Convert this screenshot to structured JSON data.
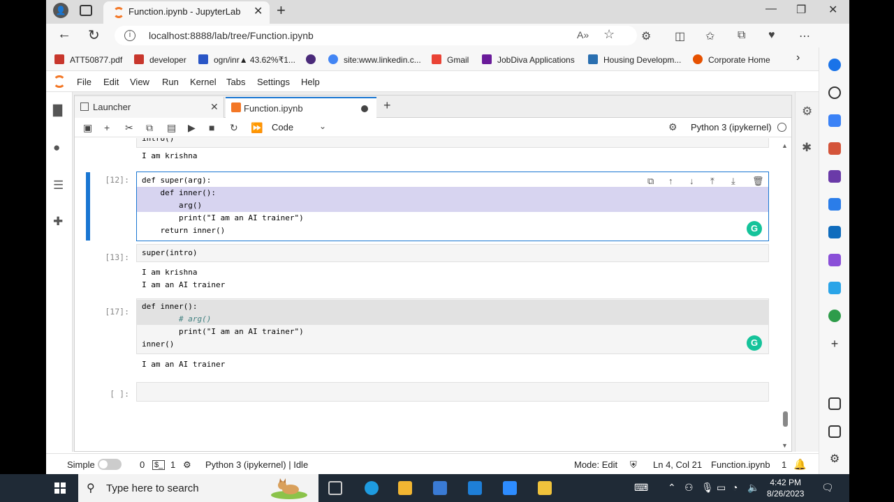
{
  "browser": {
    "tab_title": "Function.ipynb - JupyterLab",
    "url": "localhost:8888/lab/tree/Function.ipynb",
    "bookmarks": [
      {
        "label": "ATT50877.pdf",
        "color": "#c8372d"
      },
      {
        "label": "developer",
        "color": "#c8372d"
      },
      {
        "label": "ogn/inr▲ 43.62%₹1...",
        "color": "#2a56c6"
      },
      {
        "label": "",
        "color": "#4a2a7a"
      },
      {
        "label": "site:www.linkedin.c...",
        "color": "#4285f4"
      },
      {
        "label": "Gmail",
        "color": "#ea4335"
      },
      {
        "label": "JobDiva Applications",
        "color": "#6a1b9a"
      },
      {
        "label": "Housing Developm...",
        "color": "#2a6fb0"
      },
      {
        "label": "Corporate Home",
        "color": "#e65100"
      }
    ]
  },
  "jupyter": {
    "menu": [
      "File",
      "Edit",
      "View",
      "Run",
      "Kernel",
      "Tabs",
      "Settings",
      "Help"
    ],
    "dock_tabs": [
      {
        "label": "Launcher"
      },
      {
        "label": "Function.ipynb"
      }
    ],
    "cell_type": "Code",
    "kernel": "Python 3 (ipykernel)",
    "cells": {
      "c0_partial": "intro()",
      "c0_out": "I am krishna",
      "c1_prompt": "[12]:",
      "c1_code": [
        "def super(arg):",
        "    def inner():",
        "        arg()",
        "        print(\"I am an AI trainer\")",
        "    return inner()"
      ],
      "c2_prompt": "[13]:",
      "c2_code": "super(intro)",
      "c2_out": [
        "I am krishna",
        "I am an AI trainer"
      ],
      "c3_prompt": "[17]:",
      "c3_code": [
        "def inner():",
        "        # arg()",
        "        print(\"I am an AI trainer\")",
        "inner()"
      ],
      "c3_out": "I am an AI trainer",
      "c4_prompt": "[ ]:"
    },
    "status": {
      "mode_label": "Simple",
      "count_a": "0",
      "count_b": "1",
      "kernel_status": "Python 3 (ipykernel) | Idle",
      "edit_mode": "Mode: Edit",
      "cursor_pos": "Ln 4, Col 21",
      "filename": "Function.ipynb",
      "notifications": "1"
    }
  },
  "taskbar": {
    "search_placeholder": "Type here to search",
    "time": "4:42 PM",
    "date": "8/26/2023"
  }
}
